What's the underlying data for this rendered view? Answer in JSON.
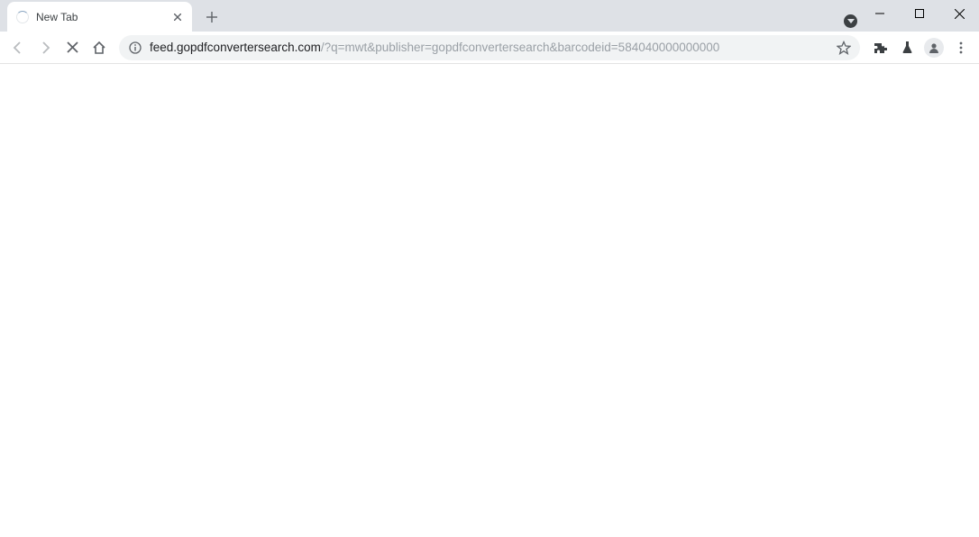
{
  "tab": {
    "title": "New Tab"
  },
  "url": {
    "domain": "feed.gopdfconvertersearch.com",
    "path": "/?q=mwt&publisher=gopdfconvertersearch&barcodeid=584040000000000"
  }
}
